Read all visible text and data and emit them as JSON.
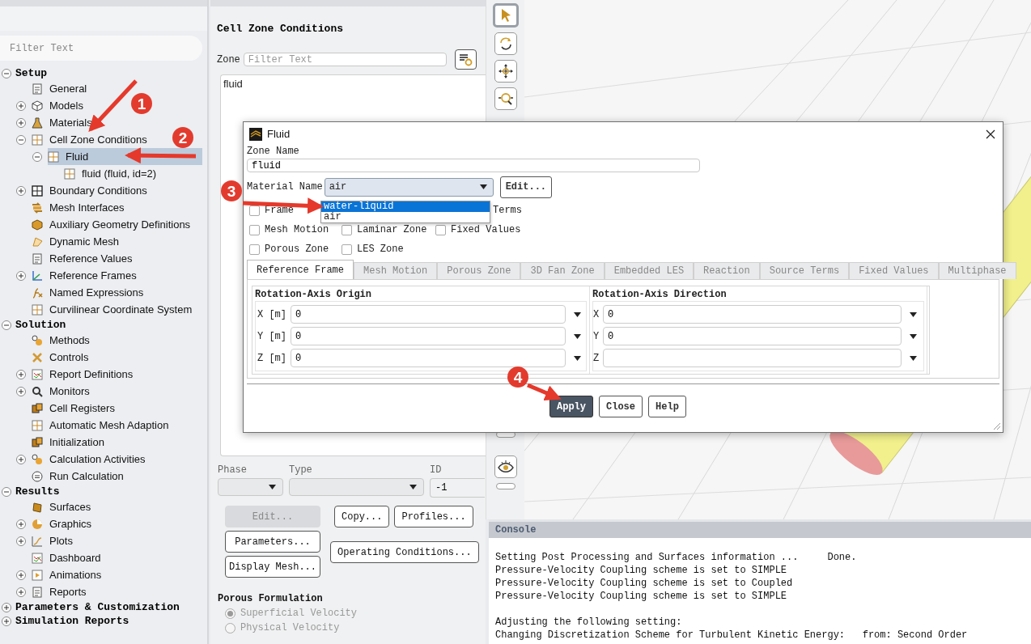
{
  "outline": {
    "filter_placeholder": "Filter Text",
    "tree": [
      {
        "label": "Setup",
        "kind": "section",
        "expanded": true,
        "selected": false,
        "children": [
          {
            "label": "General",
            "kind": "item",
            "selected": false
          },
          {
            "label": "Models",
            "kind": "item",
            "expanded": false,
            "selected": false
          },
          {
            "label": "Materials",
            "kind": "item",
            "expanded": false,
            "selected": false
          },
          {
            "label": "Cell Zone Conditions",
            "kind": "item",
            "expanded": true,
            "selected": false,
            "children": [
              {
                "label": "Fluid",
                "kind": "item",
                "expanded": true,
                "selected": true,
                "children": [
                  {
                    "label": "fluid (fluid, id=2)",
                    "kind": "item",
                    "selected": false
                  }
                ]
              }
            ]
          },
          {
            "label": "Boundary Conditions",
            "kind": "item",
            "expanded": false,
            "selected": false
          },
          {
            "label": "Mesh Interfaces",
            "kind": "item",
            "selected": false
          },
          {
            "label": "Auxiliary Geometry Definitions",
            "kind": "item",
            "selected": false
          },
          {
            "label": "Dynamic Mesh",
            "kind": "item",
            "selected": false
          },
          {
            "label": "Reference Values",
            "kind": "item",
            "selected": false
          },
          {
            "label": "Reference Frames",
            "kind": "item",
            "expanded": false,
            "selected": false
          },
          {
            "label": "Named Expressions",
            "kind": "item",
            "selected": false
          },
          {
            "label": "Curvilinear Coordinate System",
            "kind": "item",
            "selected": false
          }
        ]
      },
      {
        "label": "Solution",
        "kind": "section",
        "expanded": true,
        "selected": false,
        "children": [
          {
            "label": "Methods",
            "kind": "item",
            "selected": false
          },
          {
            "label": "Controls",
            "kind": "item",
            "selected": false
          },
          {
            "label": "Report Definitions",
            "kind": "item",
            "expanded": false,
            "selected": false
          },
          {
            "label": "Monitors",
            "kind": "item",
            "expanded": false,
            "selected": false
          },
          {
            "label": "Cell Registers",
            "kind": "item",
            "selected": false
          },
          {
            "label": "Automatic Mesh Adaption",
            "kind": "item",
            "selected": false
          },
          {
            "label": "Initialization",
            "kind": "item",
            "selected": false
          },
          {
            "label": "Calculation Activities",
            "kind": "item",
            "expanded": false,
            "selected": false
          },
          {
            "label": "Run Calculation",
            "kind": "item",
            "selected": false
          }
        ]
      },
      {
        "label": "Results",
        "kind": "section",
        "expanded": true,
        "selected": false,
        "children": [
          {
            "label": "Surfaces",
            "kind": "item",
            "selected": false
          },
          {
            "label": "Graphics",
            "kind": "item",
            "expanded": false,
            "selected": false
          },
          {
            "label": "Plots",
            "kind": "item",
            "expanded": false,
            "selected": false
          },
          {
            "label": "Dashboard",
            "kind": "item",
            "selected": false
          },
          {
            "label": "Animations",
            "kind": "item",
            "expanded": false,
            "selected": false
          },
          {
            "label": "Reports",
            "kind": "item",
            "expanded": false,
            "selected": false
          }
        ]
      },
      {
        "label": "Parameters & Customization",
        "kind": "section",
        "expanded": false,
        "selected": false
      },
      {
        "label": "Simulation Reports",
        "kind": "section",
        "expanded": false,
        "selected": false
      }
    ]
  },
  "task_page": {
    "title": "Cell Zone Conditions",
    "zone_label": "Zone",
    "zone_filter_placeholder": "Filter Text",
    "zones": [
      {
        "label": "fluid",
        "selected": false
      }
    ],
    "phase_label": "Phase",
    "type_label": "Type",
    "id_label": "ID",
    "id_value": "-1",
    "buttons_left": [
      {
        "label": "Edit...",
        "disabled": true
      },
      {
        "label": "Parameters...",
        "disabled": false
      },
      {
        "label": "Display Mesh...",
        "disabled": false
      }
    ],
    "buttons_right": [
      [
        {
          "label": "Copy...",
          "disabled": false
        },
        {
          "label": "Profiles...",
          "disabled": false
        }
      ],
      [
        {
          "label": "Operating Conditions...",
          "disabled": false
        }
      ]
    ],
    "porous_formulation": {
      "title": "Porous Formulation",
      "disabled": true,
      "options": [
        {
          "label": "Superficial Velocity",
          "selected": true
        },
        {
          "label": "Physical Velocity",
          "selected": false
        }
      ]
    }
  },
  "toolbar": {
    "tools": [
      {
        "kind": "pointer",
        "selected": true
      },
      {
        "kind": "rotate",
        "selected": false
      },
      {
        "kind": "pan",
        "selected": false
      },
      {
        "kind": "zoom",
        "selected": false
      }
    ],
    "lower_tools": [
      {
        "kind": "view",
        "selected": false
      }
    ]
  },
  "dialog": {
    "title": "Fluid",
    "zone_name_label": "Zone Name",
    "zone_name": "fluid",
    "material_label": "Material Name",
    "material_value": "air",
    "material_dropdown": {
      "expanded": true,
      "options": [
        {
          "label": "water-liquid",
          "selected": true
        },
        {
          "label": "air",
          "selected": false
        }
      ]
    },
    "edit_button": "Edit...",
    "checkbox_rows": [
      [
        {
          "label": "Frame",
          "checked": false
        }
      ],
      [
        {
          "label": "Mesh Motion",
          "checked": false
        },
        {
          "label": "Laminar Zone",
          "checked": false
        },
        {
          "label": "Fixed Values",
          "checked": false
        }
      ],
      [
        {
          "label": "Porous Zone",
          "checked": false
        },
        {
          "label": "LES Zone",
          "checked": false
        }
      ]
    ],
    "covered_text": "Terms",
    "tabs": [
      {
        "label": "Reference Frame",
        "selected": true
      },
      {
        "label": "Mesh Motion",
        "selected": false
      },
      {
        "label": "Porous Zone",
        "selected": false
      },
      {
        "label": "3D Fan Zone",
        "selected": false
      },
      {
        "label": "Embedded LES",
        "selected": false
      },
      {
        "label": "Reaction",
        "selected": false
      },
      {
        "label": "Source Terms",
        "selected": false
      },
      {
        "label": "Fixed Values",
        "selected": false
      },
      {
        "label": "Multiphase",
        "selected": false
      }
    ],
    "groups": [
      {
        "title": "Rotation-Axis Origin",
        "fields": [
          {
            "label": "X [m]",
            "value": "0"
          },
          {
            "label": "Y [m]",
            "value": "0"
          },
          {
            "label": "Z [m]",
            "value": "0"
          }
        ]
      },
      {
        "title": "Rotation-Axis Direction",
        "fields": [
          {
            "label": "X",
            "value": "0"
          },
          {
            "label": "Y",
            "value": "0"
          },
          {
            "label": "Z"
          }
        ]
      }
    ],
    "buttons": [
      {
        "label": "Apply",
        "kind": "primary"
      },
      {
        "label": "Close",
        "kind": "normal"
      },
      {
        "label": "Help",
        "kind": "normal"
      }
    ]
  },
  "console": {
    "title": "Console",
    "blocks": [
      [
        "Setting Post Processing and Surfaces information ...     Done.",
        "Pressure-Velocity Coupling scheme is set to SIMPLE",
        "Pressure-Velocity Coupling scheme is set to Coupled",
        "Pressure-Velocity Coupling scheme is set to SIMPLE"
      ],
      [
        "Adjusting the following setting:",
        "Changing Discretization Scheme for Turbulent Kinetic Energy:   from: Second Order"
      ]
    ]
  },
  "annotations": [
    {
      "number": "1"
    },
    {
      "number": "2"
    },
    {
      "number": "3"
    },
    {
      "number": "4"
    }
  ]
}
